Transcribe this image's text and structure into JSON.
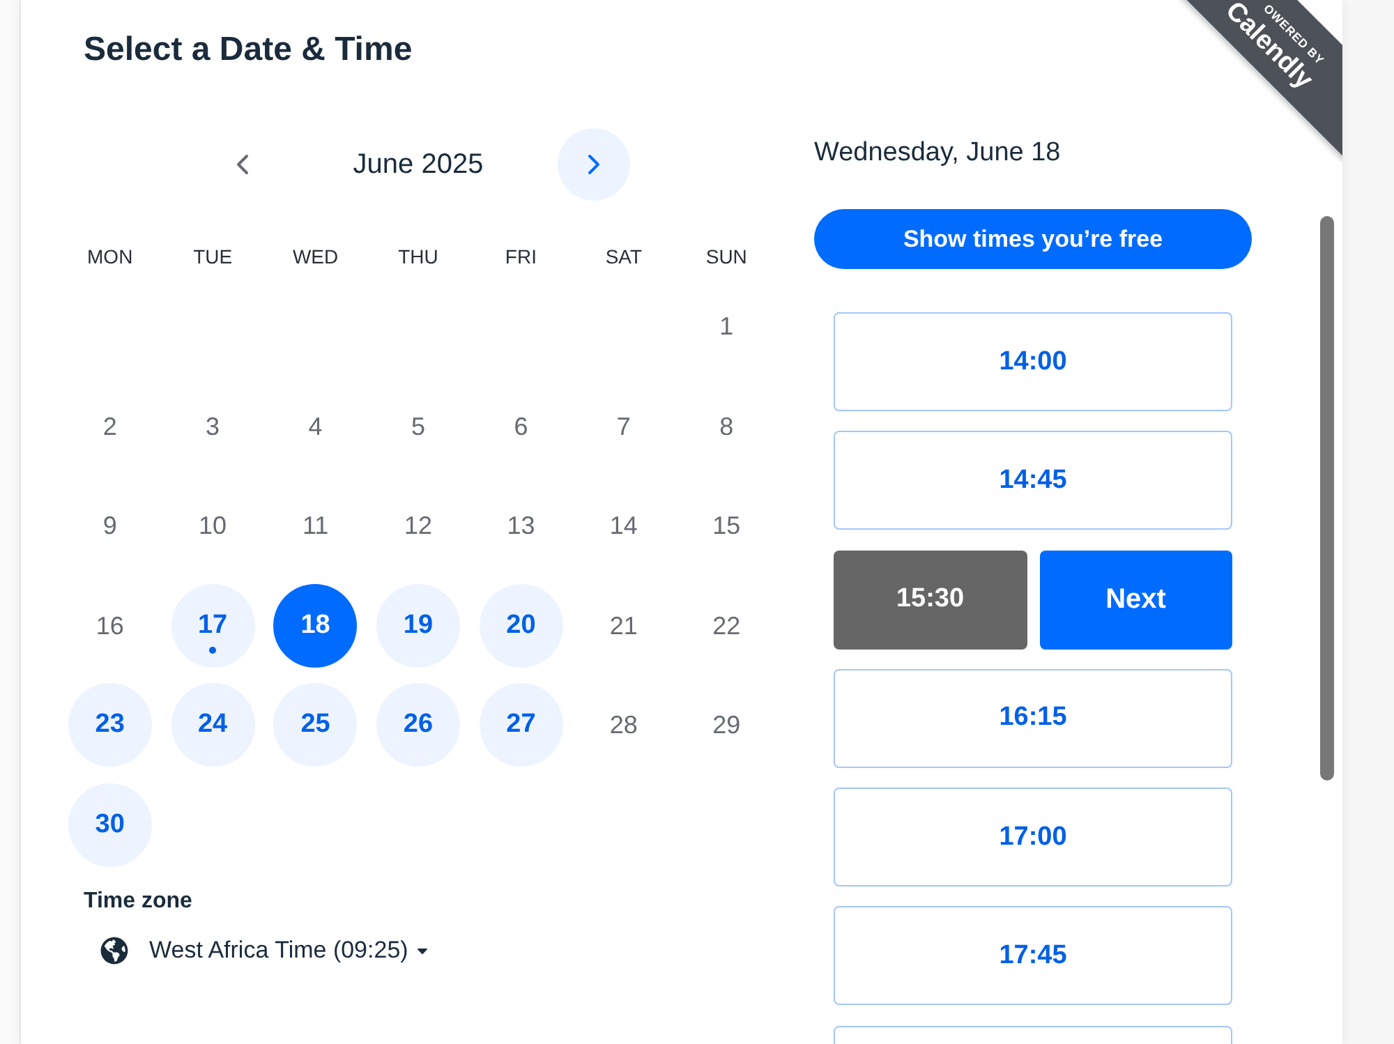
{
  "header": {
    "title": "Select a Date & Time"
  },
  "ribbon": {
    "caption": "OWERED BY",
    "brand": "Calendly"
  },
  "calendar": {
    "month": "June 2025",
    "previous": {
      "disabled": true
    },
    "next": {
      "disabled": false
    },
    "weekdays": [
      "MON",
      "TUE",
      "WED",
      "THU",
      "FRI",
      "SAT",
      "SUN"
    ],
    "weeks": [
      {
        "kind": "lead",
        "days": [
          {
            "label": "1",
            "available": false,
            "selected": false,
            "today": false
          }
        ]
      },
      {
        "kind": "full",
        "days": [
          {
            "label": "2",
            "available": false,
            "selected": false,
            "today": false
          },
          {
            "label": "3",
            "available": false,
            "selected": false,
            "today": false
          },
          {
            "label": "4",
            "available": false,
            "selected": false,
            "today": false
          },
          {
            "label": "5",
            "available": false,
            "selected": false,
            "today": false
          },
          {
            "label": "6",
            "available": false,
            "selected": false,
            "today": false
          },
          {
            "label": "7",
            "available": false,
            "selected": false,
            "today": false
          },
          {
            "label": "8",
            "available": false,
            "selected": false,
            "today": false
          }
        ]
      },
      {
        "kind": "full",
        "days": [
          {
            "label": "9",
            "available": false,
            "selected": false,
            "today": false
          },
          {
            "label": "10",
            "available": false,
            "selected": false,
            "today": false
          },
          {
            "label": "11",
            "available": false,
            "selected": false,
            "today": false
          },
          {
            "label": "12",
            "available": false,
            "selected": false,
            "today": false
          },
          {
            "label": "13",
            "available": false,
            "selected": false,
            "today": false
          },
          {
            "label": "14",
            "available": false,
            "selected": false,
            "today": false
          },
          {
            "label": "15",
            "available": false,
            "selected": false,
            "today": false
          }
        ]
      },
      {
        "kind": "full",
        "days": [
          {
            "label": "16",
            "available": false,
            "selected": false,
            "today": false
          },
          {
            "label": "17",
            "available": true,
            "selected": false,
            "today": true
          },
          {
            "label": "18",
            "available": true,
            "selected": true,
            "today": false
          },
          {
            "label": "19",
            "available": true,
            "selected": false,
            "today": false
          },
          {
            "label": "20",
            "available": true,
            "selected": false,
            "today": false
          },
          {
            "label": "21",
            "available": false,
            "selected": false,
            "today": false
          },
          {
            "label": "22",
            "available": false,
            "selected": false,
            "today": false
          }
        ]
      },
      {
        "kind": "full",
        "days": [
          {
            "label": "23",
            "available": true,
            "selected": false,
            "today": false
          },
          {
            "label": "24",
            "available": true,
            "selected": false,
            "today": false
          },
          {
            "label": "25",
            "available": true,
            "selected": false,
            "today": false
          },
          {
            "label": "26",
            "available": true,
            "selected": false,
            "today": false
          },
          {
            "label": "27",
            "available": true,
            "selected": false,
            "today": false
          },
          {
            "label": "28",
            "available": false,
            "selected": false,
            "today": false
          },
          {
            "label": "29",
            "available": false,
            "selected": false,
            "today": false
          }
        ]
      },
      {
        "kind": "tail",
        "days": [
          {
            "label": "30",
            "available": true,
            "selected": false,
            "today": false
          }
        ]
      }
    ]
  },
  "time_zone": {
    "label": "Time zone",
    "value": "West Africa Time (09:25)"
  },
  "times": {
    "date_heading": "Wednesday, June 18",
    "free_button": "Show times you’re free",
    "confirm_label": "Next",
    "slots": [
      {
        "time": "14:00",
        "selected": false
      },
      {
        "time": "14:45",
        "selected": false
      },
      {
        "time": "15:30",
        "selected": true
      },
      {
        "time": "16:15",
        "selected": false
      },
      {
        "time": "17:00",
        "selected": false
      },
      {
        "time": "17:45",
        "selected": false
      }
    ],
    "more_below": true
  }
}
